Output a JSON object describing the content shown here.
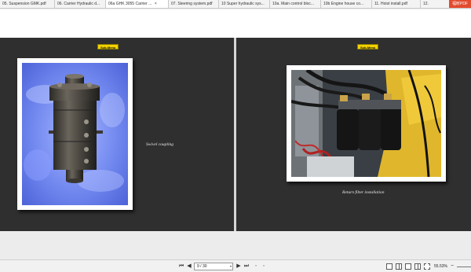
{
  "tabs": [
    {
      "label": "05. Suspension GMK.pdf",
      "closable": false
    },
    {
      "label": "06. Carrier Hydraulic d...",
      "closable": false
    },
    {
      "label": "06a GHK 3055 Carrier ...",
      "closable": true
    },
    {
      "label": "07. Steering system.pdf",
      "closable": false
    },
    {
      "label": "10 Super hydraulic sys...",
      "closable": false
    },
    {
      "label": "10a. Main control bloc...",
      "closable": false
    },
    {
      "label": "10b Engine house co...",
      "closable": false
    },
    {
      "label": "11. Hoist install.pdf",
      "closable": false
    },
    {
      "label": "12.",
      "closable": false
    }
  ],
  "brand_label": "福昕PDF",
  "pages": {
    "left": {
      "submenu_label": "Sub-Menu",
      "caption": "Swivel coupling",
      "image_subject": "swivel-coupling-photo"
    },
    "right": {
      "submenu_label": "Sub-Menu",
      "caption": "Return filter installation",
      "image_subject": "return-filter-photo"
    }
  },
  "statusbar": {
    "page_indicator": "9 / 30",
    "zoom": "55.53%"
  },
  "colors": {
    "page_background": "#2f2f2f",
    "submenu_button": "#f2d200",
    "brand": "#e34a2d"
  }
}
